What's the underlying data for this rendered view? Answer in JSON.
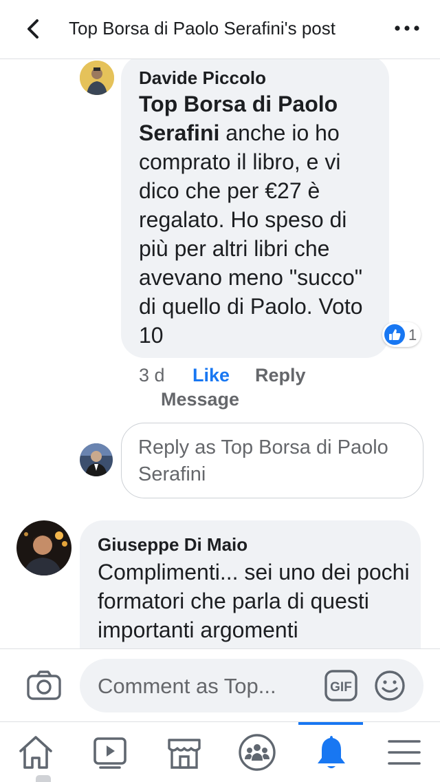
{
  "header": {
    "title": "Top Borsa di Paolo Serafini's post"
  },
  "comments": [
    {
      "author": "Davide Piccolo",
      "mention": "Top Borsa di Paolo Serafini",
      "text": " anche io ho comprato il libro, e vi dico che per €27 è regalato. Ho speso di più per altri libri che avevano meno \"succo\"  di quello di Paolo. Voto 10",
      "reaction_count": "1",
      "time": "3 d",
      "like_label": "Like",
      "reply_label": "Reply",
      "message_label": "Message"
    },
    {
      "author": "Giuseppe Di Maio",
      "text": "Complimenti... sei uno dei pochi formatori che parla di questi importanti argomenti"
    }
  ],
  "reply_box": {
    "placeholder": "Reply as Top Borsa di Paolo Serafini"
  },
  "comment_bar": {
    "placeholder": "Comment as Top...",
    "gif_label": "GIF"
  },
  "nav": {
    "items": [
      "home",
      "watch",
      "marketplace",
      "groups",
      "notifications",
      "menu"
    ],
    "active": "notifications"
  },
  "colors": {
    "accent": "#1877f2",
    "bubble": "#f0f2f5",
    "secondary_text": "#65676b",
    "primary_text": "#1c1e21"
  }
}
